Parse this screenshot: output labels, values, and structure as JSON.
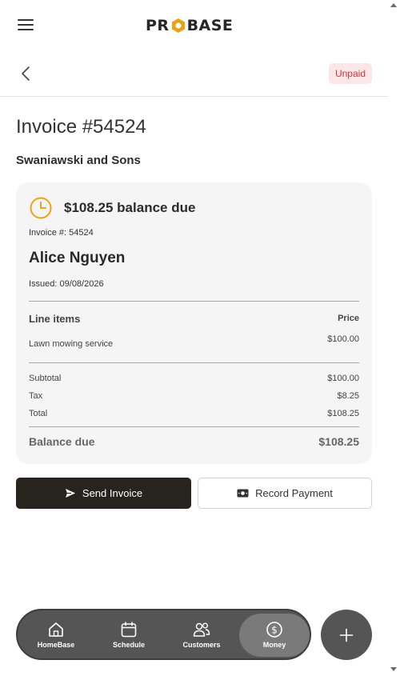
{
  "header": {
    "logo_text_left": "PR",
    "logo_text_right": "BASE",
    "status_badge": "Unpaid"
  },
  "invoice": {
    "title": "Invoice #54524",
    "company": "Swaniawski and Sons",
    "balance_headline": "$108.25 balance due",
    "invoice_number": "Invoice #: 54524",
    "client_name": "Alice Nguyen",
    "issued": "Issued: 09/08/2026",
    "line_items_label": "Line items",
    "price_label": "Price",
    "line_items": [
      {
        "description": "Lawn mowing service",
        "price": "$100.00"
      }
    ],
    "subtotal_label": "Subtotal",
    "subtotal": "$100.00",
    "tax_label": "Tax",
    "tax": "$8.25",
    "total_label": "Total",
    "total": "$108.25",
    "balance_due_label": "Balance due",
    "balance_due": "$108.25"
  },
  "actions": {
    "send_label": "Send Invoice",
    "record_label": "Record Payment"
  },
  "nav": {
    "items": [
      {
        "label": "HomeBase",
        "icon": "home-icon"
      },
      {
        "label": "Schedule",
        "icon": "calendar-icon"
      },
      {
        "label": "Customers",
        "icon": "users-icon"
      },
      {
        "label": "Money",
        "icon": "dollar-icon",
        "active": true
      }
    ]
  },
  "colors": {
    "accent": "#e8a317",
    "badge_text": "#d5343a",
    "badge_bg": "#fbe7e7",
    "primary_button": "#27231f",
    "nav_bg": "#555555"
  }
}
